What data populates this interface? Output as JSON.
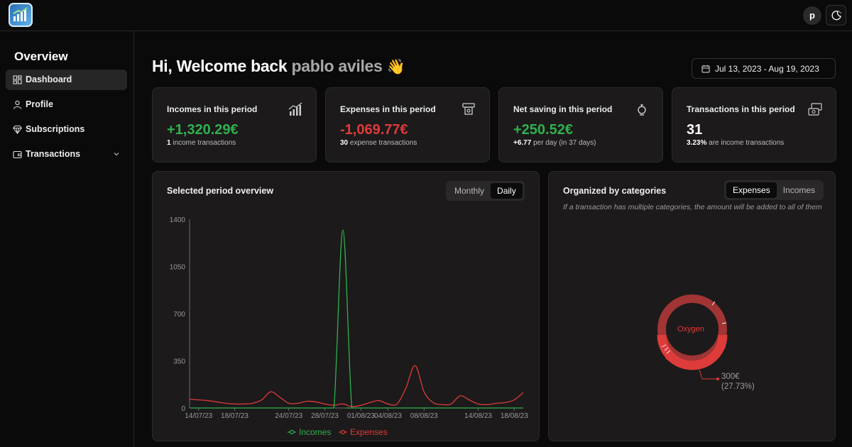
{
  "header": {
    "avatar_initial": "p"
  },
  "sidebar": {
    "title": "Overview",
    "items": [
      {
        "label": "Dashboard",
        "icon": "dashboard-icon"
      },
      {
        "label": "Profile",
        "icon": "user-icon"
      },
      {
        "label": "Subscriptions",
        "icon": "diamond-icon"
      },
      {
        "label": "Transactions",
        "icon": "wallet-icon"
      }
    ]
  },
  "main": {
    "greeting": "Hi, Welcome back",
    "username": "pablo aviles",
    "wave_emoji": "👋",
    "date_range": "Jul 13, 2023 - Aug 19, 2023"
  },
  "stats": [
    {
      "title": "Incomes in this period",
      "value": "+1,320.29€",
      "sub_bold": "1",
      "sub_text": " income transactions",
      "icon": "chart-bars-icon",
      "color": "#2fb14e"
    },
    {
      "title": "Expenses in this period",
      "value": "-1,069.77€",
      "sub_bold": "30",
      "sub_text": " expense transactions",
      "icon": "atm-icon",
      "color": "#de3b3b"
    },
    {
      "title": "Net saving in this period",
      "value": "+250.52€",
      "sub_bold": "+6.77",
      "sub_text": " per day (in 37 days)",
      "icon": "piggy-bank-icon",
      "color": "#2fb14e"
    },
    {
      "title": "Transactions in this period",
      "value": "31",
      "sub_bold": "3.23%",
      "sub_text": " are income transactions",
      "icon": "money-exchange-icon",
      "color": "#ffffff"
    }
  ],
  "overview": {
    "title": "Selected period overview",
    "toggle": [
      "Monthly",
      "Daily"
    ],
    "active_toggle": "Daily"
  },
  "categories": {
    "title": "Organized by categories",
    "toggle": [
      "Expenses",
      "Incomes"
    ],
    "active_toggle": "Expenses",
    "note": "If a transaction has multiple categories, the amount will be added to all of them",
    "center_label": "Oxygen",
    "callout_amount": "300€",
    "callout_percent": "(27.73%)"
  },
  "chart_data": {
    "type": "line",
    "x_tick_labels": [
      "14/07/23",
      "18/07/23",
      "24/07/23",
      "28/07/23",
      "01/08/23",
      "04/08/23",
      "08/08/23",
      "14/08/23",
      "18/08/23"
    ],
    "y_ticks": [
      0,
      350,
      700,
      1050,
      1400
    ],
    "ylim": [
      0,
      1400
    ],
    "legend": "bottom",
    "series": [
      {
        "name": "Incomes",
        "color": "#2fb14e",
        "points": [
          [
            "13/07/23",
            0
          ],
          [
            "27/07/23",
            0
          ],
          [
            "28/07/23",
            0
          ],
          [
            "29/07/23",
            0
          ],
          [
            "30/07/23",
            1320
          ],
          [
            "31/07/23",
            0
          ],
          [
            "01/08/23",
            0
          ],
          [
            "19/08/23",
            0
          ]
        ]
      },
      {
        "name": "Expenses",
        "color": "#de3b3b",
        "points": [
          [
            "13/07/23",
            65
          ],
          [
            "14/07/23",
            60
          ],
          [
            "15/07/23",
            55
          ],
          [
            "16/07/23",
            45
          ],
          [
            "17/07/23",
            35
          ],
          [
            "18/07/23",
            30
          ],
          [
            "19/07/23",
            30
          ],
          [
            "20/07/23",
            35
          ],
          [
            "21/07/23",
            60
          ],
          [
            "22/07/23",
            120
          ],
          [
            "23/07/23",
            80
          ],
          [
            "24/07/23",
            35
          ],
          [
            "25/07/23",
            35
          ],
          [
            "26/07/23",
            50
          ],
          [
            "27/07/23",
            45
          ],
          [
            "28/07/23",
            30
          ],
          [
            "29/07/23",
            20
          ],
          [
            "30/07/23",
            30
          ],
          [
            "31/07/23",
            10
          ],
          [
            "01/08/23",
            20
          ],
          [
            "02/08/23",
            40
          ],
          [
            "03/08/23",
            55
          ],
          [
            "04/08/23",
            30
          ],
          [
            "05/08/23",
            30
          ],
          [
            "06/08/23",
            150
          ],
          [
            "07/08/23",
            315
          ],
          [
            "08/08/23",
            120
          ],
          [
            "09/08/23",
            40
          ],
          [
            "10/08/23",
            25
          ],
          [
            "11/08/23",
            30
          ],
          [
            "12/08/23",
            90
          ],
          [
            "13/08/23",
            60
          ],
          [
            "14/08/23",
            30
          ],
          [
            "15/08/23",
            25
          ],
          [
            "16/08/23",
            35
          ],
          [
            "17/08/23",
            40
          ],
          [
            "18/08/23",
            60
          ],
          [
            "19/08/23",
            115
          ]
        ]
      }
    ]
  },
  "donut_data": {
    "type": "pie",
    "highlight": {
      "label": "Oxygen",
      "value": 300,
      "percent": 27.73,
      "color": "#de3b3b"
    },
    "other_color": "#a13434"
  }
}
